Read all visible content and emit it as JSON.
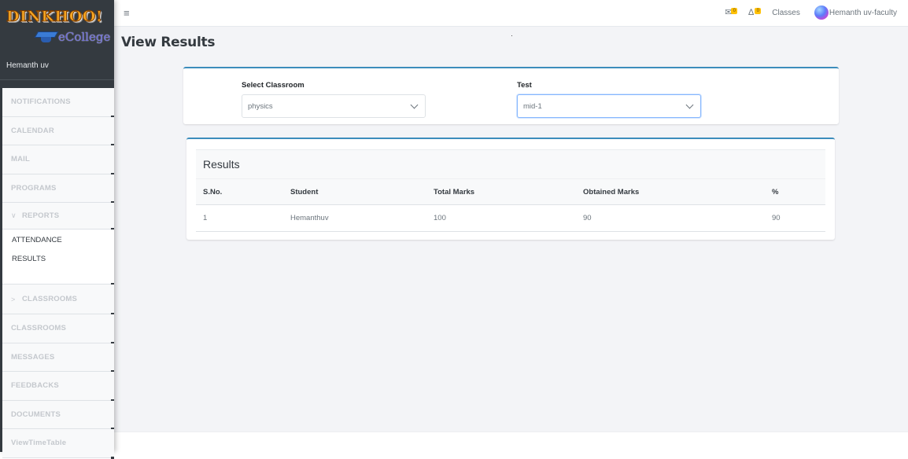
{
  "brand": {
    "name": "DINKHOO!",
    "subtitle": "eCollege",
    "icon": "graduation-cap-icon"
  },
  "sidebar": {
    "user_name": "Hemanth uv",
    "items": [
      {
        "label": "NOTIFICATIONS"
      },
      {
        "label": "CALENDAR"
      },
      {
        "label": "MAIL"
      },
      {
        "label": "PROGRAMS"
      },
      {
        "label": "REPORTS",
        "expanded": true,
        "icon": "chevron-down-icon",
        "chevron": "∨",
        "children": [
          {
            "label": "ATTENDANCE"
          },
          {
            "label": "RESULTS"
          }
        ]
      },
      {
        "label": "CLASSROOMS",
        "expanded": false,
        "icon": "chevron-right-icon",
        "chevron": ">"
      },
      {
        "label": "CLASSROOMS"
      },
      {
        "label": "MESSAGES"
      },
      {
        "label": "FEEDBACKS"
      },
      {
        "label": "DOCUMENTS"
      },
      {
        "label": "ViewTimeTable"
      }
    ]
  },
  "topbar": {
    "menu_icon": "≡",
    "mail_badge": "0",
    "notifications_badge": "0",
    "classes_label": "Classes",
    "user_label": "Hemanth uv-faculty",
    "badge_color": "#ffc107"
  },
  "page": {
    "title": "View Results"
  },
  "filters": {
    "classroom": {
      "label": "Select Classroom",
      "value": "physics"
    },
    "test": {
      "label": "Test",
      "value": "mid-1"
    }
  },
  "results": {
    "title": "Results",
    "columns": [
      "S.No.",
      "Student",
      "Total Marks",
      "Obtained Marks",
      "%"
    ],
    "rows": [
      [
        "1",
        "Hemanthuv",
        "100",
        "90",
        "90"
      ]
    ]
  },
  "colors": {
    "sidebar_bg": "#343a40",
    "accent": "#3c8dbc",
    "content_bg": "#f3f4f7"
  }
}
